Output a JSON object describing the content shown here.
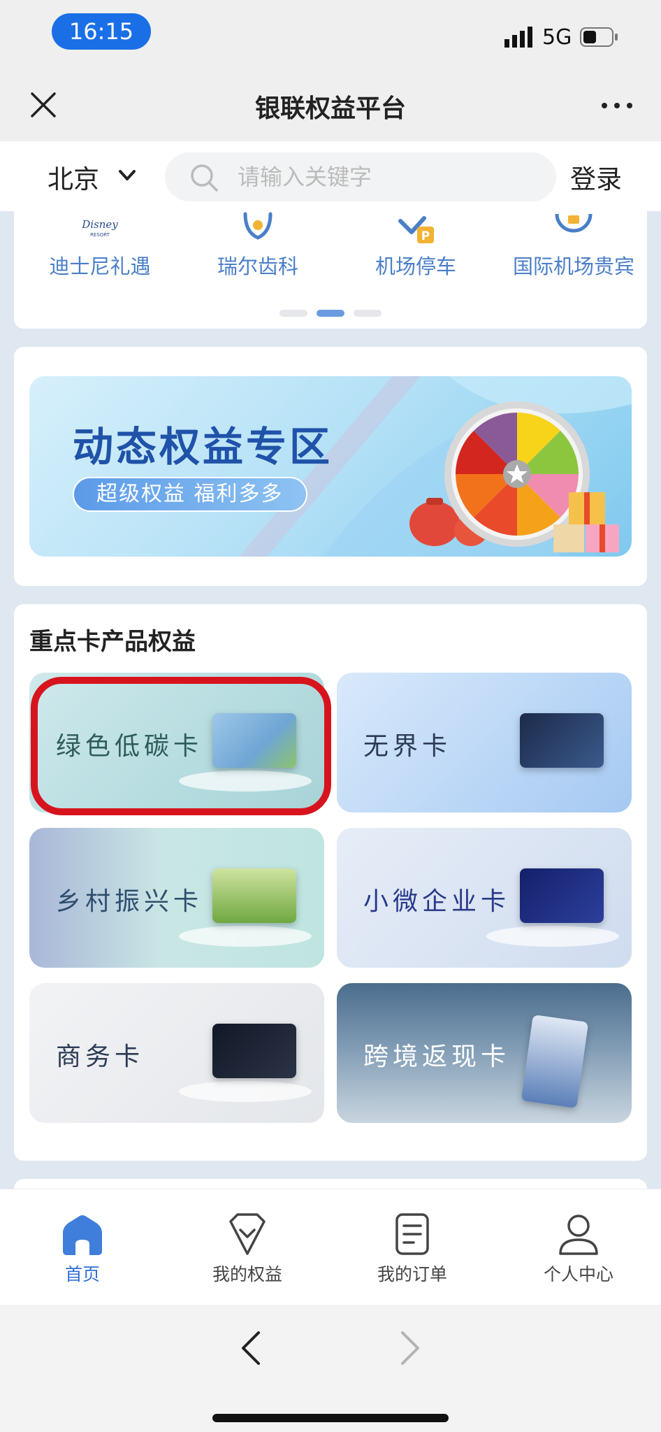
{
  "status_bar": {
    "time": "16:15",
    "network": "5G"
  },
  "title_bar": {
    "title": "银联权益平台"
  },
  "header": {
    "city": "北京",
    "search_placeholder": "请输入关键字",
    "login_label": "登录"
  },
  "shortcuts": [
    {
      "label": "迪士尼礼遇",
      "icon": "disney-resort-logo"
    },
    {
      "label": "瑞尔齿科",
      "icon": "tooth-icon"
    },
    {
      "label": "机场停车",
      "icon": "parking-icon"
    },
    {
      "label": "国际机场贵宾",
      "icon": "airport-vip-icon"
    }
  ],
  "banner": {
    "title": "动态权益专区",
    "subtitle": "超级权益 福利多多"
  },
  "card_section": {
    "title": "重点卡产品权益",
    "products": [
      {
        "label": "绿色低碳卡",
        "highlighted": true
      },
      {
        "label": "无界卡"
      },
      {
        "label": "乡村振兴卡"
      },
      {
        "label": "小微企业卡"
      },
      {
        "label": "商务卡"
      },
      {
        "label": "跨境返现卡"
      }
    ]
  },
  "tabs": [
    {
      "label": "首页",
      "icon": "home-icon",
      "active": true
    },
    {
      "label": "我的权益",
      "icon": "benefits-icon"
    },
    {
      "label": "我的订单",
      "icon": "orders-icon"
    },
    {
      "label": "个人中心",
      "icon": "profile-icon"
    }
  ],
  "colors": {
    "accent": "#2f6fd6",
    "highlight": "#d7141d",
    "banner_title": "#1f52a8",
    "time_pill": "#1a6fe6"
  }
}
